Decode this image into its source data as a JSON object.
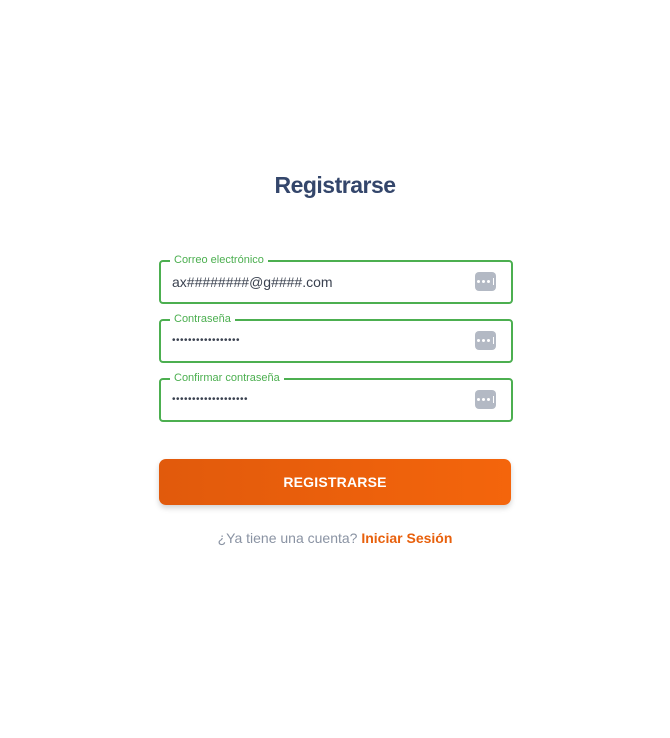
{
  "title": "Registrarse",
  "form": {
    "email": {
      "label": "Correo electrónico",
      "value": "ax########@g####.com",
      "icon": "password-manager-key-icon"
    },
    "password": {
      "label": "Contraseña",
      "value": "•••••••••••••••••",
      "icon": "password-manager-key-icon"
    },
    "confirm_password": {
      "label": "Confirmar contraseña",
      "value": "•••••••••••••••••••",
      "icon": "password-manager-key-icon"
    },
    "submit_label": "REGISTRARSE"
  },
  "footer": {
    "prompt": "¿Ya tiene una cuenta?",
    "link": "Iniciar Sesión"
  },
  "colors": {
    "title": "#34466b",
    "field_border": "#4caf50",
    "accent": "#f4650c",
    "muted_text": "#8a93a3"
  }
}
